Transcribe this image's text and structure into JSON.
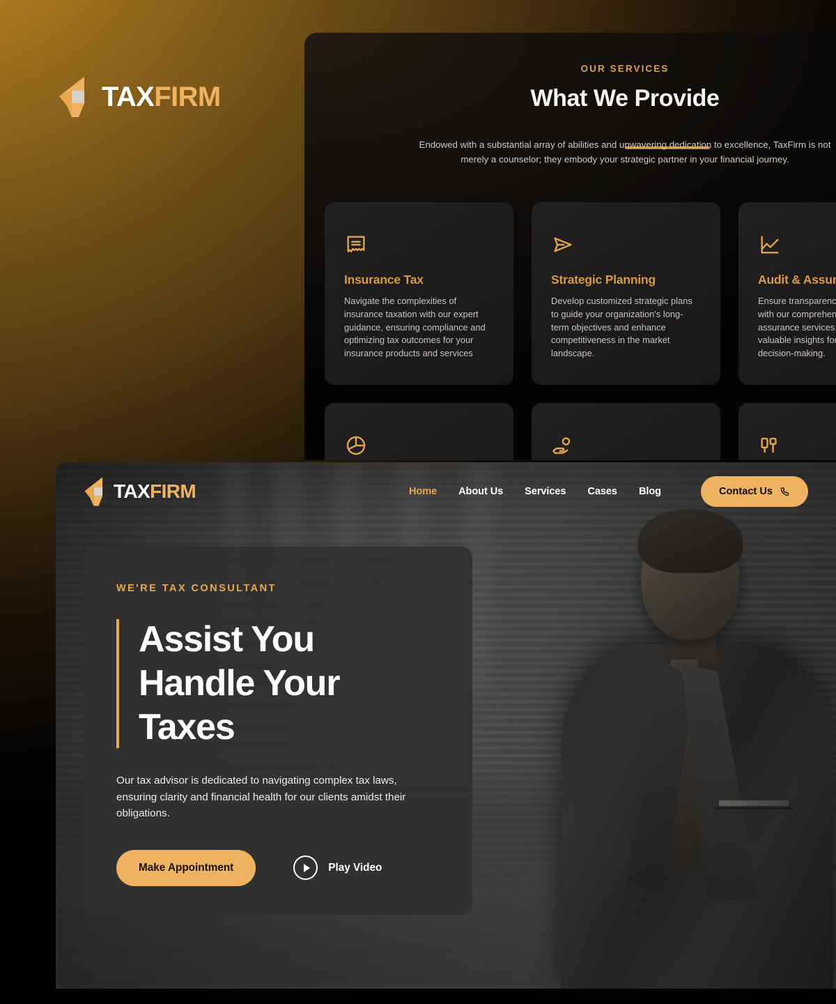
{
  "brand": {
    "tax": "TAX",
    "firm": "FIRM",
    "mark_icon": "taxfirm-logo-icon"
  },
  "colors": {
    "accent": "#efb261",
    "accent_dark": "#d79b43",
    "panel": "#1d1b1b",
    "card": "#303030"
  },
  "services": {
    "eyebrow": "OUR SERVICES",
    "title": "What We Provide",
    "lede": "Endowed with a substantial array of abilities and unwavering dedication to excellence, TaxFirm is not merely a counselor; they embody your strategic partner in your financial journey.",
    "cards": [
      {
        "icon": "receipt-icon",
        "title": "Insurance Tax",
        "desc": "Navigate the complexities of insurance taxation with our expert guidance, ensuring compliance and optimizing tax outcomes for your insurance products and services"
      },
      {
        "icon": "paper-plane-icon",
        "title": "Strategic Planning",
        "desc": "Develop customized strategic plans to guide your organization's long-term objectives and enhance competitiveness in the market landscape."
      },
      {
        "icon": "line-chart-icon",
        "title": "Audit & Assurance",
        "desc": "Ensure transparency and compliance with our comprehensive audit and assurance services, providing valuable insights for informed decision-making."
      },
      {
        "icon": "pie-chart-icon",
        "title": "",
        "desc": ""
      },
      {
        "icon": "hand-coin-icon",
        "title": "",
        "desc": ""
      },
      {
        "icon": "kanban-layout-icon",
        "title": "",
        "desc": ""
      }
    ]
  },
  "hero": {
    "nav": {
      "links": [
        {
          "label": "Home",
          "active": true
        },
        {
          "label": "About Us",
          "active": false
        },
        {
          "label": "Services",
          "active": false
        },
        {
          "label": "Cases",
          "active": false
        },
        {
          "label": "Blog",
          "active": false
        }
      ],
      "cta_label": "Contact Us",
      "cta_icon": "phone-icon"
    },
    "eyebrow": "WE'RE TAX CONSULTANT",
    "heading_line1": "Assist You",
    "heading_line2": "Handle Your",
    "heading_line3": "Taxes",
    "subtext": "Our tax advisor is dedicated to navigating complex tax laws, ensuring clarity and financial health for our clients amidst their obligations.",
    "primary_button": "Make Appointment",
    "play_label": "Play Video",
    "play_icon": "play-circle-icon",
    "photo_alt": "smiling-businessman-photo"
  }
}
